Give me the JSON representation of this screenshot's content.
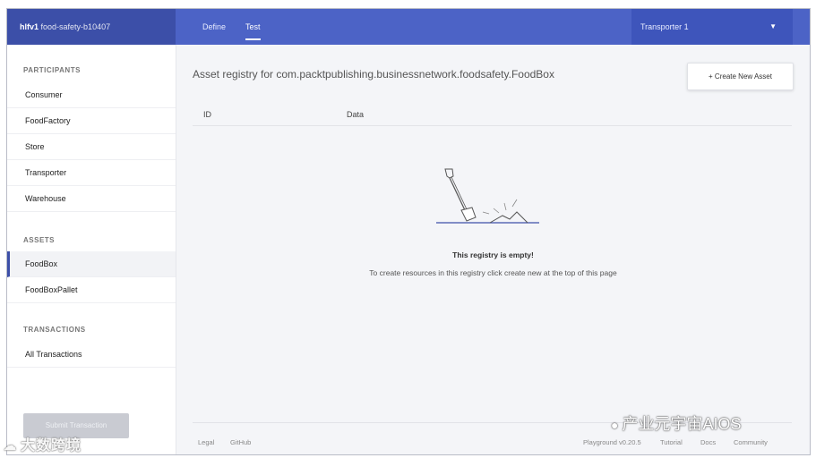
{
  "header": {
    "brand_bold": "hlfv1",
    "brand_rest": "food-safety-b10407",
    "tabs": [
      {
        "label": "Define",
        "active": false
      },
      {
        "label": "Test",
        "active": true
      }
    ],
    "identity": "Transporter 1",
    "identity_icon": "chevron-down-icon"
  },
  "sidebar": {
    "participants_title": "PARTICIPANTS",
    "participants": [
      "Consumer",
      "FoodFactory",
      "Store",
      "Transporter",
      "Warehouse"
    ],
    "assets_title": "ASSETS",
    "assets": [
      "FoodBox",
      "FoodBoxPallet"
    ],
    "selected": "FoodBox",
    "transactions_title": "TRANSACTIONS",
    "transactions": [
      "All Transactions"
    ],
    "submit_label": "Submit Transaction"
  },
  "main": {
    "title": "Asset registry for com.packtpublishing.businessnetwork.foodsafety.FoodBox",
    "create_label": "+ Create New Asset",
    "columns": [
      "ID",
      "Data"
    ],
    "empty_title": "This registry is empty!",
    "empty_sub": "To create resources in this registry click create new at the top of this page"
  },
  "footer": {
    "legal": "Legal",
    "github": "GitHub",
    "version": "Playground v0.20.5",
    "tutorial": "Tutorial",
    "docs": "Docs",
    "community": "Community"
  },
  "watermarks": {
    "left": "大数跨境",
    "right": "产业元宇宙AIOS"
  },
  "colors": {
    "header": "#4c63c6",
    "brand": "#3c4fa8",
    "selected_accent": "#3c4fa8"
  }
}
